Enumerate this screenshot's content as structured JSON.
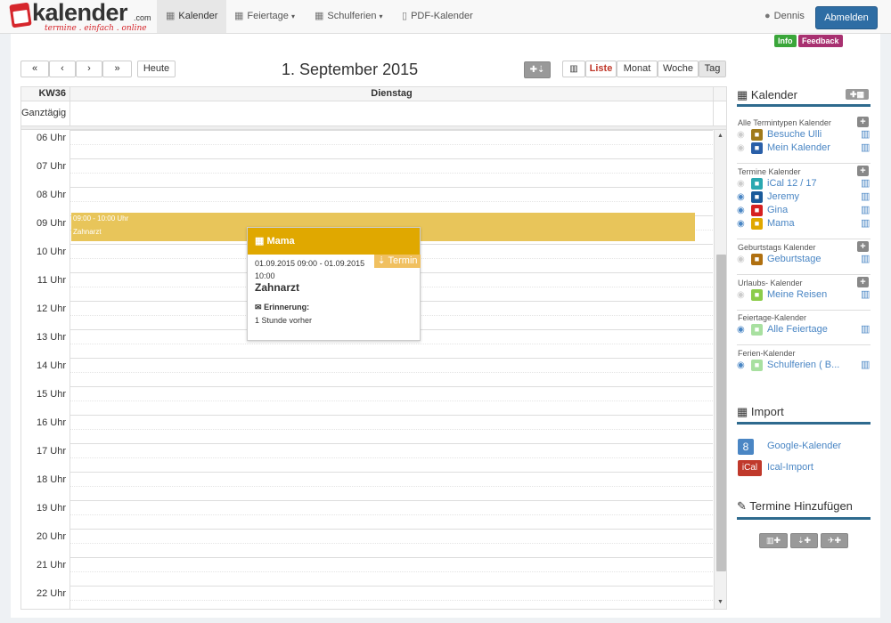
{
  "nav": {
    "logo_word": "kalender",
    "logo_com": ".com",
    "logo_tagline": "termine . einfach . online",
    "items": [
      "Kalender",
      "Feiertage",
      "Schulferien",
      "PDF-Kalender"
    ],
    "user": "Dennis",
    "logout": "Abmelden",
    "badge_info": "Info",
    "badge_feedback": "Feedback"
  },
  "toolbar": {
    "prev_prev": "«",
    "prev": "‹",
    "next": "›",
    "next_next": "»",
    "today": "Heute",
    "title": "1. September 2015",
    "view_list": "Liste",
    "view_month": "Monat",
    "view_week": "Woche",
    "view_day": "Tag"
  },
  "grid": {
    "week": "KW36",
    "day": "Dienstag",
    "all_day": "Ganztägig",
    "hours": [
      "06 Uhr",
      "07 Uhr",
      "08 Uhr",
      "09 Uhr",
      "10 Uhr",
      "11 Uhr",
      "12 Uhr",
      "13 Uhr",
      "14 Uhr",
      "15 Uhr",
      "16 Uhr",
      "17 Uhr",
      "18 Uhr",
      "19 Uhr",
      "20 Uhr",
      "21 Uhr",
      "22 Uhr"
    ]
  },
  "event": {
    "time": "09:00 - 10:00 Uhr",
    "title": "Zahnarzt",
    "color": "#e8c55a"
  },
  "popup": {
    "calendar": "Mama",
    "tag": "Termin",
    "date_range": "01.09.2015 09:00 - 01.09.2015 10:00",
    "title": "Zahnarzt",
    "reminder_label": "Erinnerung:",
    "reminder_value": "1 Stunde vorher"
  },
  "sidebar": {
    "calendar_title": "Kalender",
    "groups": [
      {
        "title": "Alle Termintypen Kalender",
        "items": [
          {
            "label": "Besuche Ulli",
            "color": "#a07a1a",
            "visible": false
          },
          {
            "label": "Mein Kalender",
            "color": "#2a5fa8",
            "visible": false
          }
        ]
      },
      {
        "title": "Termine Kalender",
        "items": [
          {
            "label": "iCal 12 / 17",
            "color": "#2aa8b0",
            "visible": false
          },
          {
            "label": "Jeremy",
            "color": "#1a5a9a",
            "visible": true
          },
          {
            "label": "Gina",
            "color": "#d62020",
            "visible": true
          },
          {
            "label": "Mama",
            "color": "#e0a800",
            "visible": true
          }
        ]
      },
      {
        "title": "Geburtstags Kalender",
        "items": [
          {
            "label": "Geburtstage",
            "color": "#b07010",
            "visible": false
          }
        ]
      },
      {
        "title": "Urlaubs- Kalender",
        "items": [
          {
            "label": "Meine Reisen",
            "color": "#8ccc4a",
            "visible": false
          }
        ]
      },
      {
        "title": "Feiertage-Kalender",
        "items": [
          {
            "label": "Alle Feiertage",
            "color": "#a8e0a0",
            "visible": true
          }
        ]
      },
      {
        "title": "Ferien-Kalender",
        "items": [
          {
            "label": "Schulferien ( B...",
            "color": "#a8e0a0",
            "visible": true
          }
        ]
      }
    ],
    "import_title": "Import",
    "import_items": [
      {
        "label": "Google-Kalender",
        "badge": "8",
        "color": "#4a86c4"
      },
      {
        "label": "Ical-Import",
        "badge": "iCal",
        "color": "#c0392b"
      }
    ],
    "add_title": "Termine Hinzufügen"
  }
}
